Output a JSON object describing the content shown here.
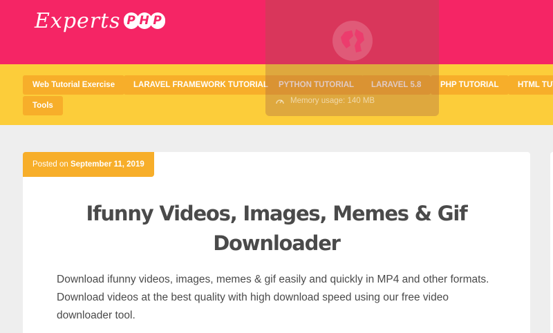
{
  "site": {
    "logo_text": "Experts",
    "logo_badge": [
      "P",
      "H",
      "P"
    ]
  },
  "nav": {
    "items": [
      {
        "label": "Web Tutorial Exercise"
      },
      {
        "label": "LARAVEL FRAMEWORK TUTORIAL"
      },
      {
        "label": "PYTHON TUTORIAL"
      },
      {
        "label": "LARAVEL 5.8"
      },
      {
        "label": "PHP TUTORIAL"
      },
      {
        "label": "HTML TUTORIAL"
      },
      {
        "label": "Tools"
      }
    ]
  },
  "overlay": {
    "icon": "globe-icon",
    "memory_label": "Memory usage: 140 MB"
  },
  "post": {
    "posted_prefix": "Posted on",
    "posted_date": "September 11, 2019",
    "title": "Ifunny Videos, Images, Memes & Gif Downloader",
    "body": "Download ifunny videos, images, memes & gif easily and quickly in MP4 and other formats. Download videos at the best quality with high download speed using our free video downloader tool."
  },
  "colors": {
    "header_pink": "#f52565",
    "nav_yellow": "#fccd3a",
    "badge_orange": "#f7ae2a",
    "page_bg": "#eeeeee",
    "text_dark": "#4a4a4a"
  }
}
